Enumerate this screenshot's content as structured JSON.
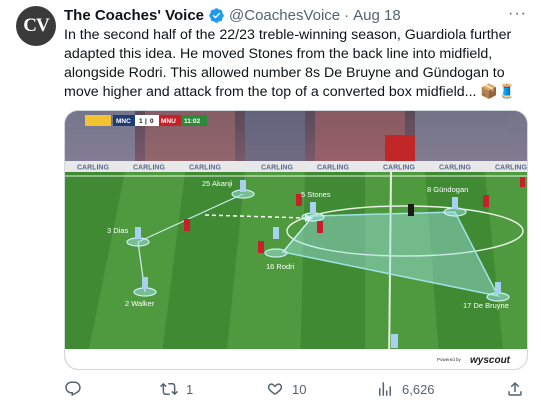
{
  "author": {
    "avatar_text": "CV",
    "name": "The Coaches' Voice",
    "handle": "@CoachesVoice",
    "date": "Aug 18"
  },
  "tweet": {
    "text": "In the second half of the 22/23 treble-winning season, Guardiola further adapted this idea. He moved Stones from the back line into midfield, alongside Rodri. This allowed number 8s De Bruyne and Gündogan to move higher and attack from the top of a converted box midfield... 📦🧵"
  },
  "media": {
    "scoreboard": {
      "home": "MNC",
      "score_home": "1",
      "score_away": "0",
      "away": "MNU",
      "clock": "11:02"
    },
    "ad_board": "CARLING",
    "players": [
      {
        "label": "25 Akanji"
      },
      {
        "label": "5 Stones"
      },
      {
        "label": "8 Gündogan"
      },
      {
        "label": "3 Dias"
      },
      {
        "label": "16 Rodri"
      },
      {
        "label": "2 Walker"
      },
      {
        "label": "17 De Bruyne"
      }
    ],
    "watermark_small": "Powered by",
    "watermark": "wyscout"
  },
  "actions": {
    "replies": "",
    "retweets": "1",
    "likes": "10",
    "views": "6,626"
  },
  "colors": {
    "verified": "#1d9bf0",
    "pitch_light": "#4f9a3f",
    "pitch_dark": "#3f8a33",
    "highlight": "#9fe3e6"
  }
}
